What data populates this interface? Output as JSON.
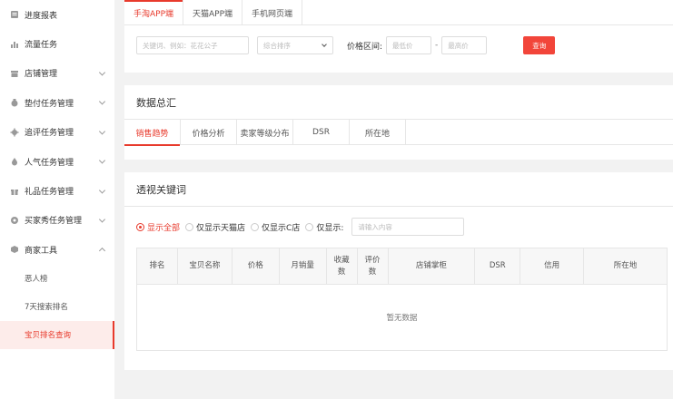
{
  "sidebar": {
    "items": [
      {
        "label": "进度报表",
        "icon": "report-icon",
        "has_chevron": false
      },
      {
        "label": "流量任务",
        "icon": "bar-chart-icon",
        "has_chevron": false
      },
      {
        "label": "店铺管理",
        "icon": "store-icon",
        "has_chevron": true
      },
      {
        "label": "垫付任务管理",
        "icon": "money-bag-icon",
        "has_chevron": true
      },
      {
        "label": "追评任务管理",
        "icon": "gear-icon",
        "has_chevron": true
      },
      {
        "label": "人气任务管理",
        "icon": "flame-icon",
        "has_chevron": true
      },
      {
        "label": "礼品任务管理",
        "icon": "gift-icon",
        "has_chevron": true
      },
      {
        "label": "买家秀任务管理",
        "icon": "star-badge-icon",
        "has_chevron": true
      },
      {
        "label": "商家工具",
        "icon": "cube-icon",
        "has_chevron": true,
        "expanded": true
      }
    ],
    "sub_items": [
      {
        "label": "恶人榜",
        "active": false
      },
      {
        "label": "7天搜索排名",
        "active": false
      },
      {
        "label": "宝贝排名查询",
        "active": true
      }
    ]
  },
  "top_tabs": [
    {
      "label": "手淘APP端",
      "active": true
    },
    {
      "label": "天猫APP端",
      "active": false
    },
    {
      "label": "手机网页端",
      "active": false
    }
  ],
  "filter": {
    "keyword_placeholder": "关键词、例如：花花公子",
    "sort_placeholder": "综合排序",
    "price_label": "价格区间:",
    "min_price_placeholder": "最低价",
    "separator": "-",
    "max_price_placeholder": "最高价",
    "query_button": "查询"
  },
  "summary": {
    "title": "数据总汇",
    "tabs": [
      {
        "label": "销售趋势",
        "active": true
      },
      {
        "label": "价格分析",
        "active": false
      },
      {
        "label": "卖家等级分布",
        "active": false
      },
      {
        "label": "DSR",
        "active": false
      },
      {
        "label": "所在地",
        "active": false
      }
    ]
  },
  "keywords": {
    "title": "透视关键词",
    "radios": [
      {
        "label": "显示全部",
        "checked": true
      },
      {
        "label": "仅显示天猫店",
        "checked": false
      },
      {
        "label": "仅显示C店",
        "checked": false
      },
      {
        "label": "仅显示:",
        "checked": false
      }
    ],
    "content_placeholder": "请输入内容",
    "table": {
      "headers": [
        "排名",
        "宝贝名称",
        "价格",
        "月销量",
        "收藏\n数",
        "评价\n数",
        "店铺掌柜",
        "DSR",
        "信用",
        "所在地"
      ],
      "empty_text": "暂无数据"
    }
  },
  "colors": {
    "accent": "#e83a2c",
    "button": "#f2453a",
    "page_bg": "#f2f2f2"
  }
}
